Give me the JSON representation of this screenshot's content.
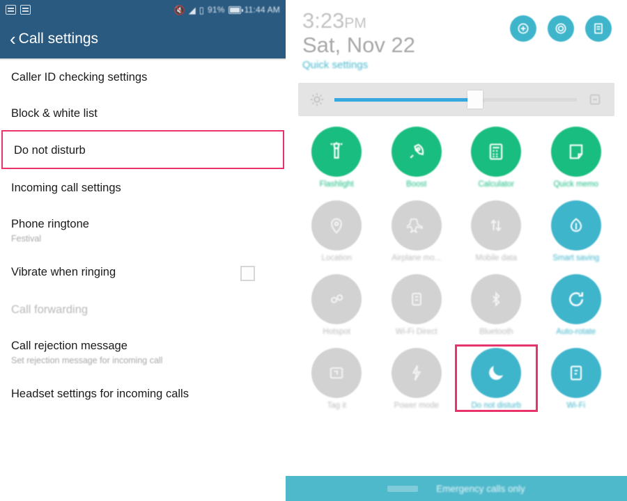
{
  "left": {
    "statusbar": {
      "icons": [
        "mail-icon",
        "gallery-icon",
        "mute-icon",
        "wifi-icon",
        "signal-icon"
      ],
      "battery": "91%",
      "time": "11:44 AM"
    },
    "titlebar": {
      "back_icon": "back-chevron-icon",
      "title": "Call settings"
    },
    "items": [
      {
        "title": "Caller ID checking settings",
        "sub": "",
        "state": "normal",
        "checkbox": false
      },
      {
        "title": "Block & white list",
        "sub": "",
        "state": "normal",
        "checkbox": false
      },
      {
        "title": "Do not disturb",
        "sub": "",
        "state": "highlight",
        "checkbox": false
      },
      {
        "title": "Incoming call settings",
        "sub": "",
        "state": "normal",
        "checkbox": false
      },
      {
        "title": "Phone ringtone",
        "sub": "Festival",
        "state": "normal",
        "checkbox": false
      },
      {
        "title": "Vibrate when ringing",
        "sub": "",
        "state": "normal",
        "checkbox": true
      },
      {
        "title": "Call forwarding",
        "sub": "",
        "state": "dim",
        "checkbox": false
      },
      {
        "title": "Call rejection message",
        "sub": "Set rejection message for incoming call",
        "state": "normal",
        "checkbox": false
      },
      {
        "title": "Headset settings for incoming calls",
        "sub": "",
        "state": "normal",
        "checkbox": false
      }
    ]
  },
  "right": {
    "clock": "3:23",
    "clock_ampm": "PM",
    "date": "Sat, Nov 22",
    "quick_settings_link": "Quick settings",
    "head_icons": [
      {
        "name": "user-switch-icon"
      },
      {
        "name": "settings-gear-icon"
      },
      {
        "name": "notes-list-icon"
      }
    ],
    "brightness": {
      "left_icon": "brightness-sun-icon",
      "right_icon": "auto-brightness-icon",
      "value_percent": 58
    },
    "tiles": [
      {
        "label": "Flashlight",
        "state": "on-green",
        "icon": "flashlight-icon",
        "highlight": false
      },
      {
        "label": "Boost",
        "state": "on-green",
        "icon": "boost-rocket-icon",
        "highlight": false
      },
      {
        "label": "Calculator",
        "state": "on-green",
        "icon": "calculator-icon",
        "highlight": false
      },
      {
        "label": "Quick memo",
        "state": "on-green",
        "icon": "quick-memo-icon",
        "highlight": false
      },
      {
        "label": "Location",
        "state": "off",
        "icon": "location-pin-icon",
        "highlight": false
      },
      {
        "label": "Airplane mo...",
        "state": "off",
        "icon": "airplane-icon",
        "highlight": false
      },
      {
        "label": "Mobile data",
        "state": "off",
        "icon": "mobile-data-icon",
        "highlight": false
      },
      {
        "label": "Smart saving",
        "state": "on-teal",
        "icon": "smart-saving-icon",
        "highlight": false
      },
      {
        "label": "Hotspot",
        "state": "off",
        "icon": "hotspot-icon",
        "highlight": false
      },
      {
        "label": "Wi-Fi Direct",
        "state": "off",
        "icon": "wifi-direct-icon",
        "highlight": false
      },
      {
        "label": "Bluetooth",
        "state": "off",
        "icon": "bluetooth-icon",
        "highlight": false
      },
      {
        "label": "Auto-rotate",
        "state": "on-teal",
        "icon": "sync-rotate-icon",
        "highlight": false
      },
      {
        "label": "Tag it",
        "state": "off",
        "icon": "nfc-tag-icon",
        "highlight": false
      },
      {
        "label": "Power mode",
        "state": "off",
        "icon": "power-mode-icon",
        "highlight": false
      },
      {
        "label": "Do not disturb",
        "state": "on-teal",
        "icon": "moon-icon",
        "highlight": true
      },
      {
        "label": "Wi-Fi",
        "state": "on-teal",
        "icon": "wifi-tile-icon",
        "highlight": false
      }
    ],
    "bottom": {
      "text": "Emergency calls only"
    }
  },
  "colors": {
    "header_blue": "#2b5a80",
    "accent_green": "#19bd7f",
    "accent_teal": "#3fb5cc",
    "highlight_red": "#e8336b",
    "bottom_bar": "#4fb9cc"
  }
}
